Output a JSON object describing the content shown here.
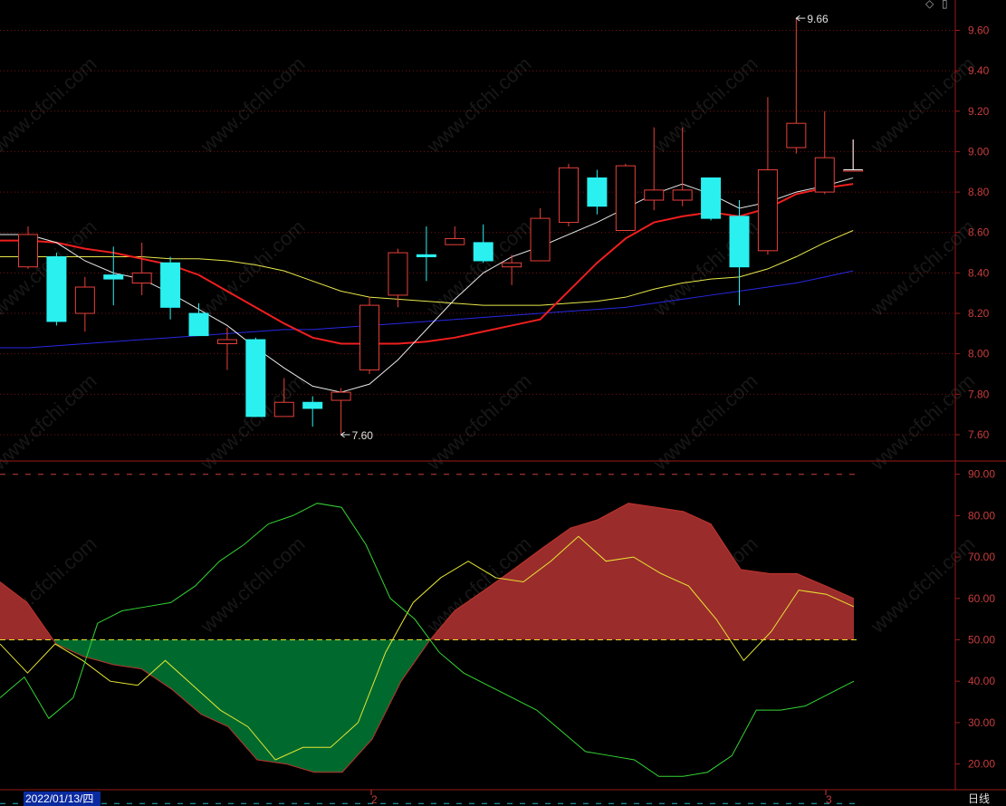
{
  "chart_data": [
    {
      "type": "candlestick",
      "ylim": [
        7.47,
        9.75
      ],
      "yticks": [
        "9.60",
        "9.40",
        "9.20",
        "9.00",
        "8.80",
        "8.60",
        "8.40",
        "8.20",
        "8.00",
        "7.80",
        "7.60"
      ],
      "candles": [
        {
          "o": 8.43,
          "h": 8.63,
          "l": 8.42,
          "c": 8.59
        },
        {
          "o": 8.48,
          "h": 8.5,
          "l": 8.14,
          "c": 8.16
        },
        {
          "o": 8.2,
          "h": 8.38,
          "l": 8.11,
          "c": 8.33
        },
        {
          "o": 8.39,
          "h": 8.53,
          "l": 8.24,
          "c": 8.37
        },
        {
          "o": 8.35,
          "h": 8.55,
          "l": 8.29,
          "c": 8.4
        },
        {
          "o": 8.45,
          "h": 8.48,
          "l": 8.17,
          "c": 8.23
        },
        {
          "o": 8.2,
          "h": 8.25,
          "l": 8.09,
          "c": 8.09
        },
        {
          "o": 8.05,
          "h": 8.13,
          "l": 7.92,
          "c": 8.07
        },
        {
          "o": 8.07,
          "h": 8.08,
          "l": 7.69,
          "c": 7.69
        },
        {
          "o": 7.69,
          "h": 7.88,
          "l": 7.69,
          "c": 7.76
        },
        {
          "o": 7.76,
          "h": 7.79,
          "l": 7.64,
          "c": 7.73
        },
        {
          "o": 7.77,
          "h": 7.83,
          "l": 7.6,
          "c": 7.81
        },
        {
          "o": 7.92,
          "h": 8.28,
          "l": 7.9,
          "c": 8.24
        },
        {
          "o": 8.29,
          "h": 8.52,
          "l": 8.23,
          "c": 8.5
        },
        {
          "o": 8.49,
          "h": 8.63,
          "l": 8.36,
          "c": 8.48
        },
        {
          "o": 8.54,
          "h": 8.63,
          "l": 8.54,
          "c": 8.57
        },
        {
          "o": 8.55,
          "h": 8.64,
          "l": 8.45,
          "c": 8.46
        },
        {
          "o": 8.43,
          "h": 8.49,
          "l": 8.34,
          "c": 8.45
        },
        {
          "o": 8.46,
          "h": 8.72,
          "l": 8.46,
          "c": 8.67
        },
        {
          "o": 8.65,
          "h": 8.94,
          "l": 8.63,
          "c": 8.92
        },
        {
          "o": 8.87,
          "h": 8.91,
          "l": 8.69,
          "c": 8.73
        },
        {
          "o": 8.61,
          "h": 8.94,
          "l": 8.61,
          "c": 8.93
        },
        {
          "o": 8.76,
          "h": 9.12,
          "l": 8.71,
          "c": 8.81
        },
        {
          "o": 8.76,
          "h": 9.12,
          "l": 8.73,
          "c": 8.81
        },
        {
          "o": 8.87,
          "h": 8.87,
          "l": 8.66,
          "c": 8.67
        },
        {
          "o": 8.68,
          "h": 8.76,
          "l": 8.24,
          "c": 8.43
        },
        {
          "o": 8.51,
          "h": 9.27,
          "l": 8.49,
          "c": 8.91
        },
        {
          "o": 9.02,
          "h": 9.66,
          "l": 8.99,
          "c": 9.14
        },
        {
          "o": 8.8,
          "h": 9.2,
          "l": 8.79,
          "c": 8.97
        },
        {
          "o": 8.91,
          "h": 9.06,
          "l": 8.91,
          "c": 8.91
        }
      ],
      "ma_white": [
        8.59,
        8.55,
        8.46,
        8.4,
        8.37,
        8.3,
        8.22,
        8.14,
        8.03,
        7.93,
        7.84,
        7.81,
        7.85,
        7.97,
        8.12,
        8.27,
        8.4,
        8.48,
        8.53,
        8.59,
        8.65,
        8.72,
        8.79,
        8.84,
        8.79,
        8.72,
        8.75,
        8.8,
        8.83,
        8.87
      ],
      "ma_red": [
        8.56,
        8.55,
        8.52,
        8.5,
        8.47,
        8.44,
        8.39,
        8.31,
        8.23,
        8.15,
        8.08,
        8.05,
        8.05,
        8.05,
        8.06,
        8.08,
        8.11,
        8.14,
        8.17,
        8.31,
        8.45,
        8.57,
        8.65,
        8.68,
        8.7,
        8.68,
        8.72,
        8.79,
        8.82,
        8.84
      ],
      "ma_yellow": [
        8.48,
        8.48,
        8.48,
        8.48,
        8.48,
        8.47,
        8.47,
        8.46,
        8.44,
        8.41,
        8.36,
        8.31,
        8.28,
        8.27,
        8.26,
        8.25,
        8.24,
        8.24,
        8.24,
        8.25,
        8.26,
        8.28,
        8.32,
        8.35,
        8.37,
        8.38,
        8.42,
        8.48,
        8.55,
        8.61
      ],
      "ma_blue": [
        8.03,
        8.04,
        8.05,
        8.06,
        8.07,
        8.08,
        8.09,
        8.1,
        8.11,
        8.12,
        8.12,
        8.13,
        8.14,
        8.15,
        8.16,
        8.17,
        8.18,
        8.19,
        8.2,
        8.21,
        8.22,
        8.23,
        8.25,
        8.27,
        8.29,
        8.31,
        8.33,
        8.35,
        8.38,
        8.41
      ],
      "annotations": [
        {
          "label": "9.66",
          "candle": 27,
          "price": 9.66
        },
        {
          "label": "7.60",
          "candle": 11,
          "price": 7.6
        }
      ],
      "colors": {
        "up": "#e8403a",
        "down": "#2af0f0",
        "ma_white": "#e8e8e8",
        "ma_red": "#f01e1e",
        "ma_yellow": "#e8e84a",
        "ma_blue": "#2828e6",
        "grid": "#7a1010"
      }
    },
    {
      "type": "area",
      "ylim": [
        14,
        93
      ],
      "yticks": [
        "90.00",
        "80.00",
        "70.00",
        "60.00",
        "50.00",
        "40.00",
        "30.00",
        "20.00"
      ],
      "x_points": [
        0,
        30,
        62,
        92,
        125,
        156,
        190,
        222,
        252,
        284,
        316,
        347,
        378,
        411,
        443,
        475,
        502,
        535,
        567,
        598,
        630,
        660,
        694,
        725,
        755,
        785,
        818,
        850,
        880,
        912,
        943
      ],
      "main": [
        64,
        59,
        49,
        46,
        44,
        43,
        38,
        32,
        29,
        21,
        20,
        18,
        18,
        26,
        40,
        50,
        57,
        62,
        67,
        72,
        77,
        79,
        83,
        82,
        81,
        78,
        67,
        66,
        66,
        63,
        60
      ],
      "yellow": [
        49,
        42,
        49,
        45,
        40,
        39,
        45,
        39,
        33,
        29,
        21,
        24,
        24,
        30,
        47,
        59,
        65,
        69,
        65,
        64,
        69,
        75,
        69,
        70,
        66,
        63,
        55,
        45,
        52,
        62,
        61,
        58
      ],
      "green": [
        36,
        41,
        31,
        36,
        54,
        57,
        58,
        59,
        63,
        69,
        73,
        78,
        80,
        83,
        82,
        73,
        60,
        55,
        47,
        42,
        39,
        36,
        33,
        28,
        23,
        22,
        21,
        17,
        17,
        18,
        22,
        33,
        33,
        34,
        37,
        40
      ],
      "baseline": 50,
      "upper_dash": 90,
      "lower_dash": 10,
      "colors": {
        "up_fill": "#9b2c2c",
        "down_fill": "#006a2e",
        "yellow": "#e6e632",
        "green": "#34d534",
        "base": "#e6e632",
        "dash": "#c83c3c"
      }
    }
  ],
  "x_labels": [
    "2022/01/13/四",
    "2",
    "3"
  ],
  "period_label": "日线",
  "watermark": "www.cfchi.com",
  "top_icons": [
    "◇",
    "▯"
  ]
}
